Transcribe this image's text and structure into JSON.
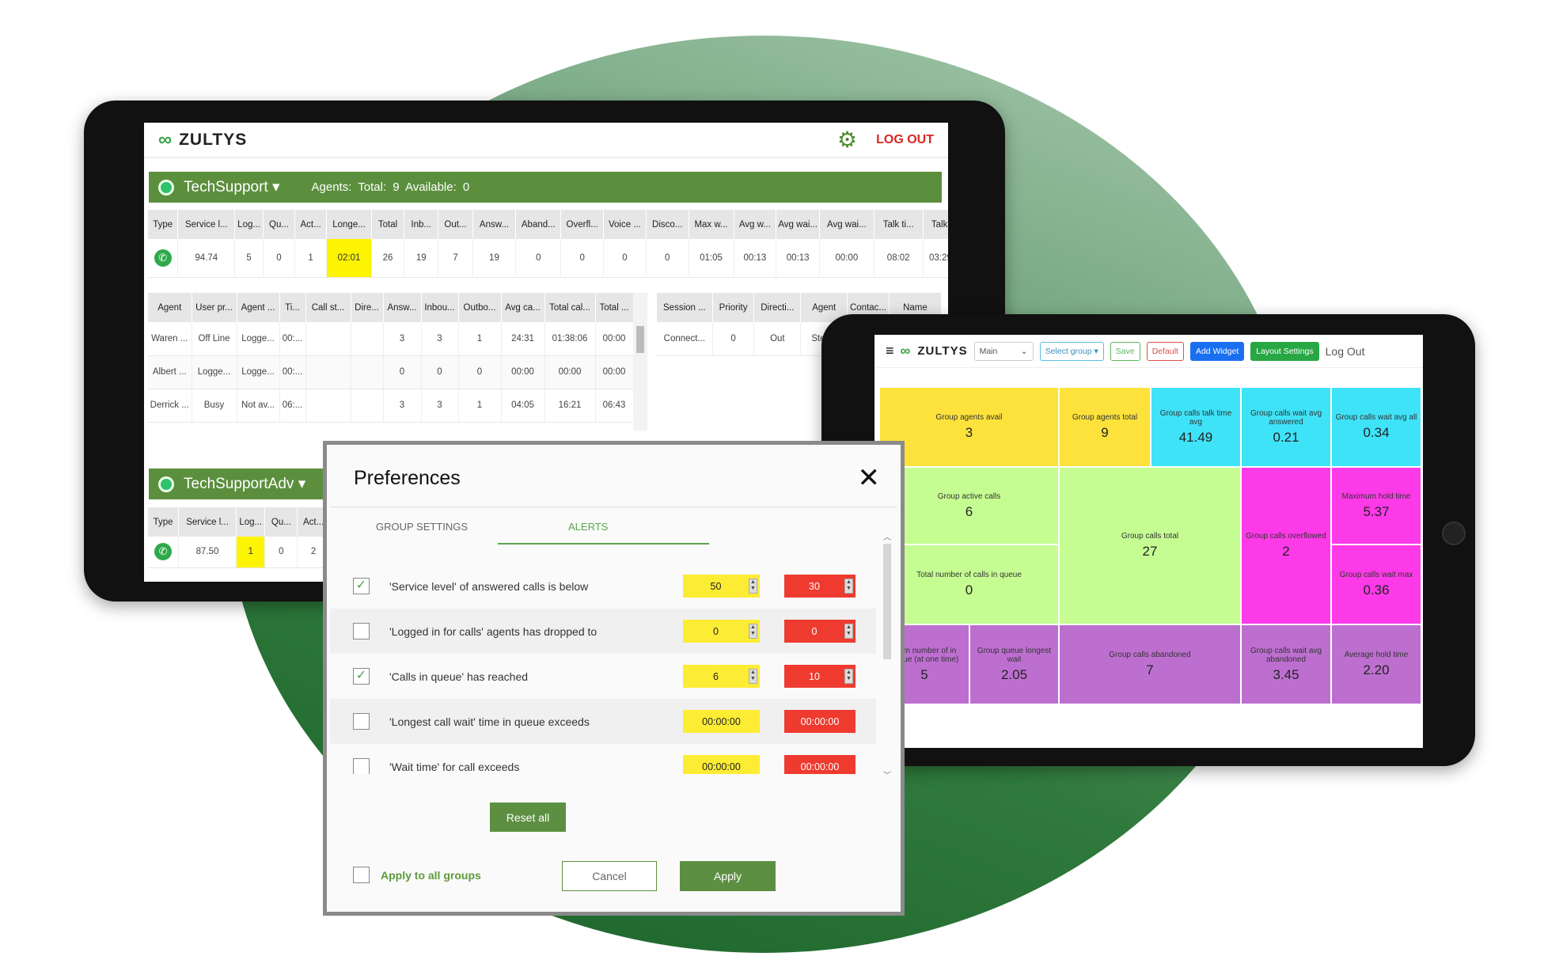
{
  "left_app": {
    "brand": "ZULTYS",
    "logout": "LOG OUT",
    "group1": {
      "name": "TechSupport",
      "summary": "Agents: Total: 9   Available: 0"
    },
    "stats_headers": [
      "Type",
      "Service l...",
      "Log...",
      "Qu...",
      "Act...",
      "Longe...",
      "Total",
      "Inb...",
      "Out...",
      "Answ...",
      "Aband...",
      "Overfl...",
      "Voice ...",
      "Disco...",
      "Max w...",
      "Avg w...",
      "Avg wai...",
      "Avg wai...",
      "Talk ti...",
      "Talk ti..."
    ],
    "stats_row": [
      "",
      "94.74",
      "5",
      "0",
      "1",
      "02:01",
      "26",
      "19",
      "7",
      "19",
      "0",
      "0",
      "0",
      "0",
      "01:05",
      "00:13",
      "00:13",
      "00:00",
      "08:02",
      "03:29:06"
    ],
    "agents_headers": [
      "Agent",
      "User pr...",
      "Agent ...",
      "Ti...",
      "Call st...",
      "Dire...",
      "Answ...",
      "Inbou...",
      "Outbo...",
      "Avg ca...",
      "Total cal...",
      "Total ..."
    ],
    "agents_rows": [
      [
        "Waren ...",
        "Off Line",
        "Logge...",
        "00:...",
        "",
        "",
        "3",
        "3",
        "1",
        "24:31",
        "01:38:06",
        "00:00"
      ],
      [
        "Albert ...",
        "Logge...",
        "Logge...",
        "00:...",
        "",
        "",
        "0",
        "0",
        "0",
        "00:00",
        "00:00",
        "00:00"
      ],
      [
        "Derrick ...",
        "Busy",
        "Not av...",
        "06:...",
        "",
        "",
        "3",
        "3",
        "1",
        "04:05",
        "16:21",
        "06:43"
      ]
    ],
    "sessions_headers": [
      "Session ...",
      "Priority",
      "Directi...",
      "Agent",
      "Contac...",
      "Name"
    ],
    "sessions_rows": [
      [
        "Connect...",
        "0",
        "Out",
        "Stev...",
        "",
        ""
      ]
    ],
    "group2": {
      "name": "TechSupportAdv",
      "headers": [
        "Type",
        "Service l...",
        "Log...",
        "Qu...",
        "Act..."
      ],
      "row": [
        "",
        "87.50",
        "1",
        "0",
        "2"
      ]
    }
  },
  "right_app": {
    "brand": "ZULTYS",
    "view_select": "Main",
    "select_group": "Select group",
    "save": "Save",
    "default": "Default",
    "add_widget": "Add Widget",
    "layout_settings": "Layout Settings",
    "logout": "Log Out",
    "tiles": [
      {
        "label": "Group agents avail",
        "value": "3",
        "color": "#fde23b"
      },
      {
        "label": "Group agents total",
        "value": "9",
        "color": "#fde23b"
      },
      {
        "label": "Group calls talk time avg",
        "value": "41.49",
        "color": "#3fe3f8"
      },
      {
        "label": "Group calls wait avg answered",
        "value": "0.21",
        "color": "#3fe3f8"
      },
      {
        "label": "Group calls wait avg all",
        "value": "0.34",
        "color": "#3fe3f8"
      },
      {
        "label": "Group active calls",
        "value": "6",
        "color": "#c6fd92"
      },
      {
        "label": "Group calls total",
        "value": "27",
        "color": "#c6fd92"
      },
      {
        "label": "Group calls overflowed",
        "value": "2",
        "color": "#fc3ae8"
      },
      {
        "label": "Maximum hold time",
        "value": "5.37",
        "color": "#fc3ae8"
      },
      {
        "label": "Total number of calls in queue",
        "value": "0",
        "color": "#c6fd92"
      },
      {
        "label": "Group calls wait max",
        "value": "0.36",
        "color": "#fc3ae8"
      },
      {
        "label": "mum number of in queue (at one time)",
        "value": "5",
        "color": "#bd6fd0"
      },
      {
        "label": "Group queue longest wait",
        "value": "2.05",
        "color": "#bd6fd0"
      },
      {
        "label": "Group calls abandoned",
        "value": "7",
        "color": "#bd6fd0"
      },
      {
        "label": "Group calls wait avg abandoned",
        "value": "3.45",
        "color": "#bd6fd0"
      },
      {
        "label": "Average hold time",
        "value": "2.20",
        "color": "#bd6fd0"
      }
    ]
  },
  "dialog": {
    "title": "Preferences",
    "tabs": [
      {
        "label": "GROUP SETTINGS",
        "active": false
      },
      {
        "label": "ALERTS",
        "active": true
      }
    ],
    "alerts": [
      {
        "label": "'Service level' of answered calls is below",
        "checked": true,
        "warn": "50",
        "crit": "30"
      },
      {
        "label": "'Logged in for calls' agents has dropped to",
        "checked": false,
        "warn": "0",
        "crit": "0"
      },
      {
        "label": "'Calls in queue' has reached",
        "checked": true,
        "warn": "6",
        "crit": "10"
      },
      {
        "label": "'Longest call wait' time in queue exceeds",
        "checked": false,
        "warn": "00:00:00",
        "crit": "00:00:00"
      },
      {
        "label": "'Wait time' for call exceeds",
        "checked": false,
        "warn": "00:00:00",
        "crit": "00:00:00"
      }
    ],
    "reset_all": "Reset all",
    "apply_all_groups": "Apply to all groups",
    "apply_all_checked": false,
    "cancel": "Cancel",
    "apply": "Apply"
  },
  "colors": {
    "brand_green": "#5b8f3d",
    "warn": "#fdec34",
    "crit": "#ef3a2f",
    "logout_red": "#d7261f",
    "add_widget_blue": "#1a6ff0"
  }
}
